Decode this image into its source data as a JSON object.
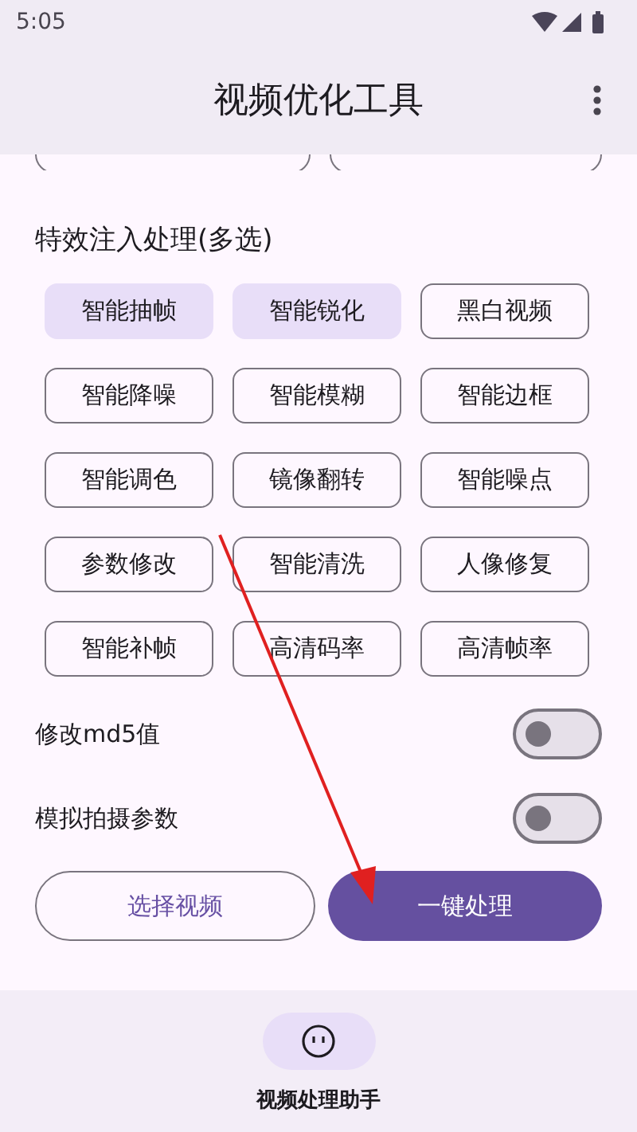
{
  "status_bar": {
    "time": "5:05"
  },
  "app_bar": {
    "title": "视频优化工具"
  },
  "section_title": "特效注入处理(多选)",
  "effects": [
    {
      "label": "智能抽帧",
      "selected": true
    },
    {
      "label": "智能锐化",
      "selected": true
    },
    {
      "label": "黑白视频",
      "selected": false
    },
    {
      "label": "智能降噪",
      "selected": false
    },
    {
      "label": "智能模糊",
      "selected": false
    },
    {
      "label": "智能边框",
      "selected": false
    },
    {
      "label": "智能调色",
      "selected": false
    },
    {
      "label": "镜像翻转",
      "selected": false
    },
    {
      "label": "智能噪点",
      "selected": false
    },
    {
      "label": "参数修改",
      "selected": false
    },
    {
      "label": "智能清洗",
      "selected": false
    },
    {
      "label": "人像修复",
      "selected": false
    },
    {
      "label": "智能补帧",
      "selected": false
    },
    {
      "label": "高清码率",
      "selected": false
    },
    {
      "label": "高清帧率",
      "selected": false
    }
  ],
  "switches": [
    {
      "label": "修改md5值",
      "on": false
    },
    {
      "label": "模拟拍摄参数",
      "on": false
    }
  ],
  "buttons": [
    {
      "label": "选择视频",
      "kind": "outlined"
    },
    {
      "label": "一键处理",
      "kind": "filled"
    }
  ],
  "bottom_nav": [
    {
      "label": "视频处理助手",
      "selected": true
    }
  ]
}
